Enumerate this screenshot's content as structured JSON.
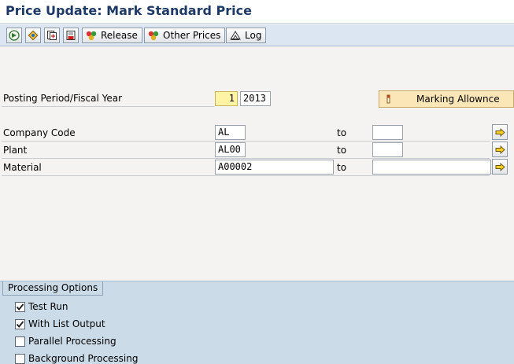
{
  "title": "Price Update: Mark Standard Price",
  "toolbar": {
    "icon_buttons": [
      "execute-icon",
      "variant-icon",
      "get-variant-icon",
      "save-variant-icon"
    ],
    "release_label": "Release",
    "other_prices_label": "Other Prices",
    "log_label": "Log"
  },
  "posting": {
    "label": "Posting Period/Fiscal Year",
    "period_value": "1",
    "year_value": "2013"
  },
  "marking_allowance_label": "Marking Allownce",
  "selection": {
    "to_label": "to",
    "rows": [
      {
        "label": "Company Code",
        "from": "AL",
        "to": ""
      },
      {
        "label": "Plant",
        "from": "AL00",
        "to": ""
      },
      {
        "label": "Material",
        "from": "A00002",
        "to": ""
      }
    ]
  },
  "processing": {
    "title": "Processing Options",
    "options": [
      {
        "label": "Test Run",
        "checked": true
      },
      {
        "label": "With List Output",
        "checked": true
      },
      {
        "label": "Parallel Processing",
        "checked": false
      },
      {
        "label": "Background Processing",
        "checked": false
      }
    ]
  },
  "colors": {
    "title_text": "#1d3a66",
    "toolbar_bg": "#dbe6f2",
    "panel_bg": "#ccdbe8",
    "required_field": "#fff3a6",
    "marking_button": "#fbe6b8"
  }
}
